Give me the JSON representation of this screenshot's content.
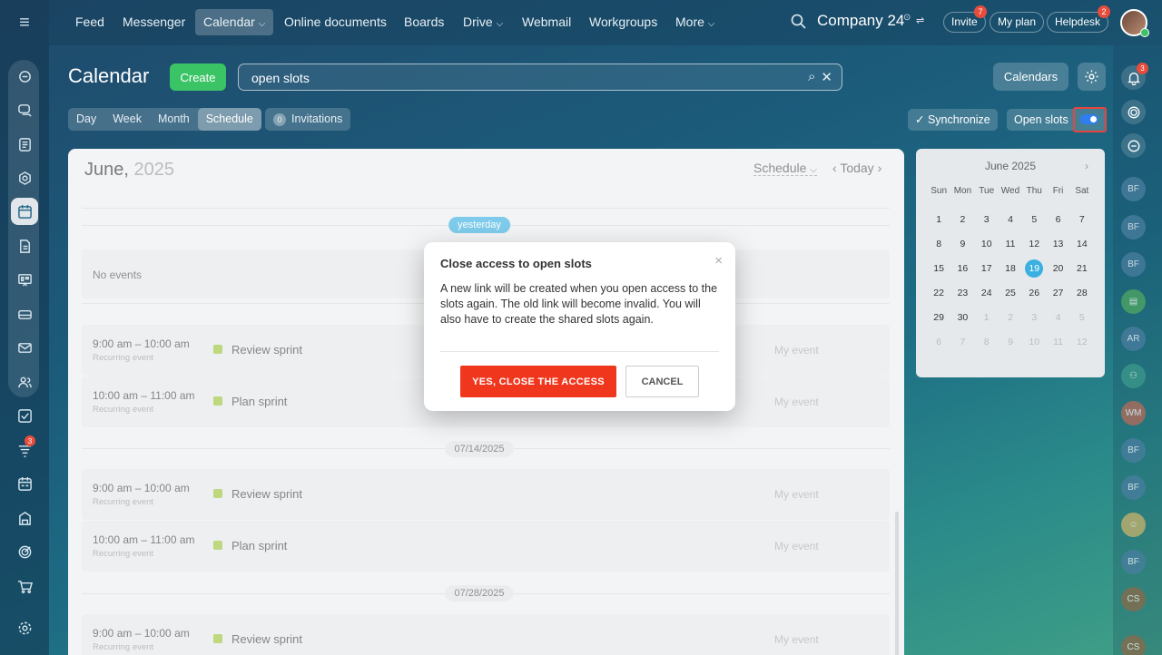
{
  "topnav": {
    "items": [
      "Feed",
      "Messenger",
      "Calendar",
      "Online documents",
      "Boards",
      "Drive",
      "Webmail",
      "Workgroups",
      "More"
    ],
    "company": "Company 24",
    "invite": {
      "label": "Invite",
      "badge": "7"
    },
    "myplan": "My plan",
    "helpdesk": {
      "label": "Helpdesk",
      "badge": "2"
    }
  },
  "header": {
    "title": "Calendar",
    "create": "Create",
    "search_value": "open slots",
    "calendars": "Calendars"
  },
  "views": {
    "tabs": [
      "Day",
      "Week",
      "Month",
      "Schedule"
    ],
    "invitations_count": "0",
    "invitations": "Invitations",
    "synchronize": "Synchronize",
    "open_slots": "Open slots"
  },
  "main": {
    "month": "June,",
    "year": "2025",
    "schedule_select": "Schedule",
    "today": "Today",
    "yesterday": "yesterday",
    "no_events": "No events",
    "date1": "07/14/2025",
    "date2": "07/28/2025",
    "events": [
      {
        "time": "9:00 am – 10:00 am",
        "sub": "Recurring event",
        "name": "Review sprint",
        "tag": "My event"
      },
      {
        "time": "10:00 am – 11:00 am",
        "sub": "Recurring event",
        "name": "Plan sprint",
        "tag": "My event"
      },
      {
        "time": "9:00 am – 10:00 am",
        "sub": "Recurring event",
        "name": "Review sprint",
        "tag": "My event"
      },
      {
        "time": "10:00 am – 11:00 am",
        "sub": "Recurring event",
        "name": "Plan sprint",
        "tag": "My event"
      },
      {
        "time": "9:00 am – 10:00 am",
        "sub": "Recurring event",
        "name": "Review sprint",
        "tag": "My event"
      }
    ]
  },
  "minical": {
    "title": "June 2025",
    "dow": [
      "Sun",
      "Mon",
      "Tue",
      "Wed",
      "Thu",
      "Fri",
      "Sat"
    ],
    "weeks": [
      [
        "1",
        "2",
        "3",
        "4",
        "5",
        "6",
        "7"
      ],
      [
        "8",
        "9",
        "10",
        "11",
        "12",
        "13",
        "14"
      ],
      [
        "15",
        "16",
        "17",
        "18",
        "19",
        "20",
        "21"
      ],
      [
        "22",
        "23",
        "24",
        "25",
        "26",
        "27",
        "28"
      ],
      [
        "29",
        "30",
        "1",
        "2",
        "3",
        "4",
        "5"
      ],
      [
        "6",
        "7",
        "8",
        "9",
        "10",
        "11",
        "12"
      ]
    ],
    "today": "19"
  },
  "modal": {
    "title": "Close access to open slots",
    "body": "A new link will be created when you open access to the slots again. The old link will become invalid. You will also have to create the shared slots again.",
    "yes": "YES, CLOSE THE ACCESS",
    "cancel": "CANCEL"
  },
  "leftbar": {
    "badge": "3"
  },
  "rightbar": {
    "bell_badge": "3",
    "avatars": [
      "BF",
      "BF",
      "BF",
      "AR",
      "WM",
      "BF",
      "BF",
      "BF",
      "CS",
      "CS"
    ]
  },
  "colors": {
    "accent": "#3bb0e0",
    "create": "#3bc466",
    "danger": "#f0371e",
    "toggle": "#2f7ef0"
  }
}
